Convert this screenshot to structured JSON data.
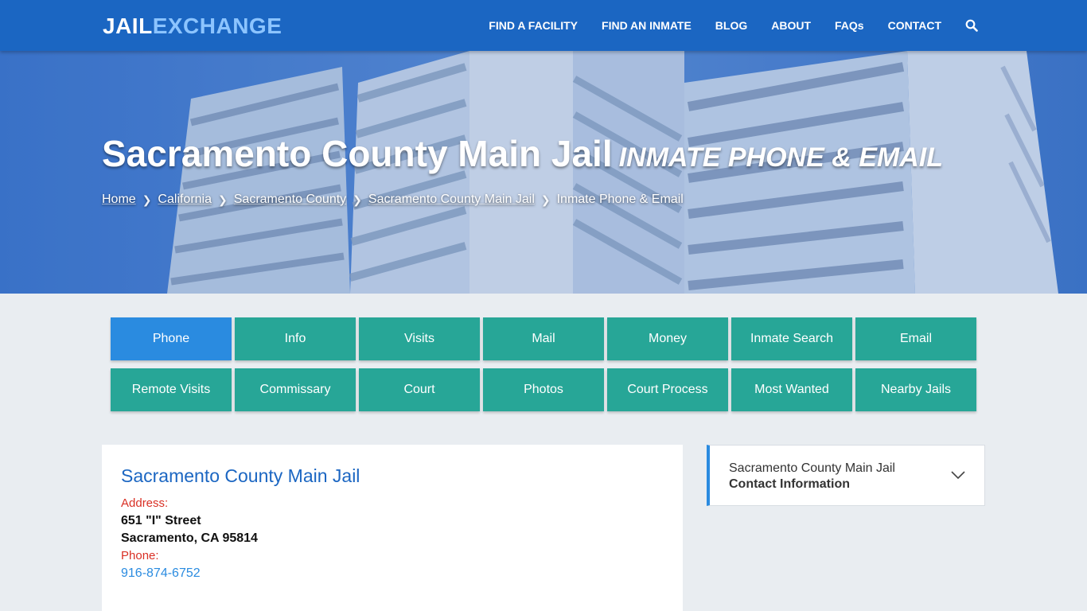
{
  "header": {
    "logo_part1": "JAIL",
    "logo_part2": "EXCHANGE",
    "nav": [
      "FIND A FACILITY",
      "FIND AN INMATE",
      "BLOG",
      "ABOUT",
      "FAQs",
      "CONTACT"
    ],
    "search_icon": "search-icon"
  },
  "hero": {
    "title": "Sacramento County Main Jail",
    "subtitle": "Inmate Phone & Email",
    "breadcrumbs": [
      "Home",
      "California",
      "Sacramento County",
      "Sacramento County Main Jail",
      "Inmate Phone & Email"
    ]
  },
  "tabs": [
    [
      "Phone",
      "Info",
      "Visits",
      "Mail",
      "Money",
      "Inmate Search",
      "Email"
    ],
    [
      "Remote Visits",
      "Commissary",
      "Court",
      "Photos",
      "Court Process",
      "Most Wanted",
      "Nearby Jails"
    ]
  ],
  "active_tab": "Phone",
  "card": {
    "title": "Sacramento County Main Jail",
    "address_label": "Address:",
    "address_line1": "651 \"I\" Street",
    "address_line2": "Sacramento, CA 95814",
    "phone_label": "Phone:",
    "phone": "916-874-6752"
  },
  "sidebar": {
    "line1": "Sacramento County Main Jail",
    "line2": "Contact Information",
    "icon": "chevron-down-icon"
  },
  "colors": {
    "header_bg": "#1b66c2",
    "tab_bg": "#27a697",
    "tab_active": "#2a8be0",
    "label_red": "#d93025",
    "link_blue": "#2a8be0"
  }
}
